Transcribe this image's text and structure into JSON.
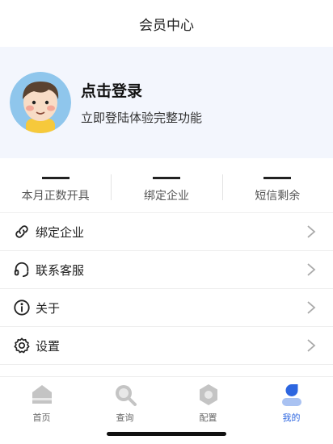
{
  "header": {
    "title": "会员中心"
  },
  "profile": {
    "login_title": "点击登录",
    "login_subtitle": "立即登陆体验完整功能"
  },
  "stats": [
    {
      "value": "—",
      "label": "本月正数开具"
    },
    {
      "value": "—",
      "label": "绑定企业"
    },
    {
      "value": "—",
      "label": "短信剩余"
    }
  ],
  "menu": [
    {
      "label": "绑定企业",
      "icon": "link-icon"
    },
    {
      "label": "联系客服",
      "icon": "headset-icon"
    },
    {
      "label": "关于",
      "icon": "info-icon"
    },
    {
      "label": "设置",
      "icon": "gear-icon"
    }
  ],
  "tabbar": [
    {
      "label": "首页",
      "icon": "home-icon",
      "active": false
    },
    {
      "label": "查询",
      "icon": "search-icon",
      "active": false
    },
    {
      "label": "配置",
      "icon": "config-icon",
      "active": false
    },
    {
      "label": "我的",
      "icon": "profile-icon",
      "active": true
    }
  ],
  "colors": {
    "accent": "#2d66e0",
    "profile_bg": "#f3f6fd",
    "inactive_icon": "#c4c4c4"
  }
}
